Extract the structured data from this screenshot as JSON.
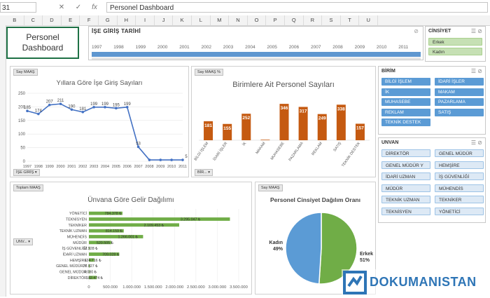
{
  "formula_bar": {
    "name_box": "31",
    "cancel_icon": "✕",
    "enter_icon": "✓",
    "fx_label": "fx",
    "text": "Personel Dashboard"
  },
  "columns": [
    "B",
    "C",
    "D",
    "E",
    "F",
    "G",
    "H",
    "I",
    "J",
    "K",
    "L",
    "M",
    "N",
    "O",
    "P",
    "Q",
    "R",
    "S",
    "T",
    "U"
  ],
  "title": {
    "line1": "Personel",
    "line2": "Dashboard"
  },
  "timeline": {
    "title": "İŞE GİRİŞ  TARİHİ",
    "years": [
      "1997",
      "1998",
      "1999",
      "2000",
      "2001",
      "2002",
      "2003",
      "2004",
      "2005",
      "2006",
      "2007",
      "2008",
      "2009",
      "2010",
      "2011"
    ]
  },
  "slicer_cinsiyet": {
    "title": "CİNSİYET",
    "items": [
      "Erkek",
      "Kadın"
    ]
  },
  "slicer_birim": {
    "title": "BİRİM",
    "items": [
      "BİLGİ İŞLEM",
      "İDARİ İŞLER",
      "İK",
      "MAKAM",
      "MUHASEBE",
      "PAZARLAMA",
      "REKLAM",
      "SATIŞ",
      "TEKNİK DESTEK"
    ]
  },
  "slicer_unvan": {
    "title": "UNVAN",
    "items": [
      "DİREKTÖR",
      "GENEL MÜDÜR",
      "GENEL MÜDÜR Y",
      "HEMŞİRE",
      "İDARİ UZMAN",
      "İŞ GÜVENLİĞİ",
      "MÜDÜR",
      "MÜHENDİS",
      "TEKNİK UZMAN",
      "TEKNİKER",
      "TEKNİSYEN",
      "YÖNETİCİ"
    ]
  },
  "chart_line": {
    "field_btn": "Say MAAŞ",
    "filter_btn": "İŞE GİRİŞ",
    "chart_data": {
      "type": "line",
      "title": "Yıllara Göre İşe Giriş Sayıları",
      "categories": [
        "1997",
        "1998",
        "1999",
        "2000",
        "2001",
        "2002",
        "2003",
        "2004",
        "2005",
        "2006",
        "2007",
        "2008",
        "2009",
        "2010",
        "2011"
      ],
      "values": [
        185,
        174,
        207,
        211,
        190,
        181,
        199,
        199,
        195,
        199,
        53,
        5,
        5,
        5,
        5
      ],
      "labels": [
        "185",
        "174",
        "207",
        "211",
        "190",
        "181",
        "199",
        "199",
        "195",
        "199",
        "53",
        "",
        "",
        "",
        "5"
      ],
      "yticks": [
        "250",
        "200",
        "150",
        "100",
        "50",
        "0"
      ],
      "ylim": [
        0,
        250
      ]
    }
  },
  "chart_bar_birim": {
    "field_btn": "Say MAAŞ",
    "field_btn2": "%",
    "filter_btn": "BİR...",
    "chart_data": {
      "type": "bar",
      "title": "Birimlere Ait Personel Sayıları",
      "categories": [
        "BİLGİ İŞLEM",
        "İDARİ İŞLER",
        "İK",
        "MAKAM",
        "MUHASEBE",
        "PAZARLAMA",
        "REKLAM",
        "SATIŞ",
        "TEKNİK DESTEK"
      ],
      "values": [
        181,
        155,
        252,
        5,
        346,
        317,
        249,
        338,
        157
      ],
      "labels": [
        "181",
        "155",
        "252",
        "",
        "346",
        "317",
        "249",
        "338",
        "157"
      ],
      "ylim": [
        0,
        400
      ],
      "color": "#c55a11"
    }
  },
  "chart_hbar_unvan": {
    "field_btn": "Toplam MAAŞ",
    "filter_btn": "UNV...",
    "chart_data": {
      "type": "bar",
      "orientation": "horizontal",
      "title": "Ünvana Göre Gelir Dağılımı",
      "categories": [
        "YÖNETİCİ",
        "TEKNİSYEN",
        "TEKNİKER",
        "TEKNİK UZMAN",
        "MÜHENDİS",
        "MÜDÜR",
        "İŞ GÜVENLİĞİ",
        "İDARİ UZMAN",
        "HEMŞİRE",
        "GENEL MÜDÜR Y",
        "GENEL MÜDÜR",
        "DİREKTÖR"
      ],
      "values": [
        784378,
        3295047,
        2109453,
        814159,
        1266001,
        520505,
        12928,
        709028,
        124716,
        20027,
        4080,
        182474
      ],
      "labels": [
        "784.378 ₺",
        "3.295.047 ₺",
        "2.109.453 ₺",
        "814.159 ₺",
        "1.266.001 ₺",
        "520.505 ₺",
        "12.928 ₺",
        "709.028 ₺",
        "124.716 ₺",
        "20.027 ₺",
        "4.080 ₺",
        "182.474 ₺"
      ],
      "xticks": [
        "0",
        "500.000",
        "1.000.000",
        "1.500.000",
        "2.000.000",
        "2.500.000",
        "3.000.000",
        "3.500.000"
      ],
      "xlim": [
        0,
        3500000
      ],
      "color": "#70ad47"
    }
  },
  "chart_pie": {
    "field_btn": "Say MAAŞ",
    "chart_data": {
      "type": "pie",
      "title": "Personel Cinsiyet Dağılım Oranı",
      "categories": [
        "Erkek",
        "Kadın"
      ],
      "values": [
        51,
        49
      ],
      "labels": [
        "51%",
        "49%"
      ],
      "colors": [
        "#70ad47",
        "#5b9bd5"
      ]
    }
  },
  "watermark": {
    "text": "DOKUMANISTAN"
  }
}
